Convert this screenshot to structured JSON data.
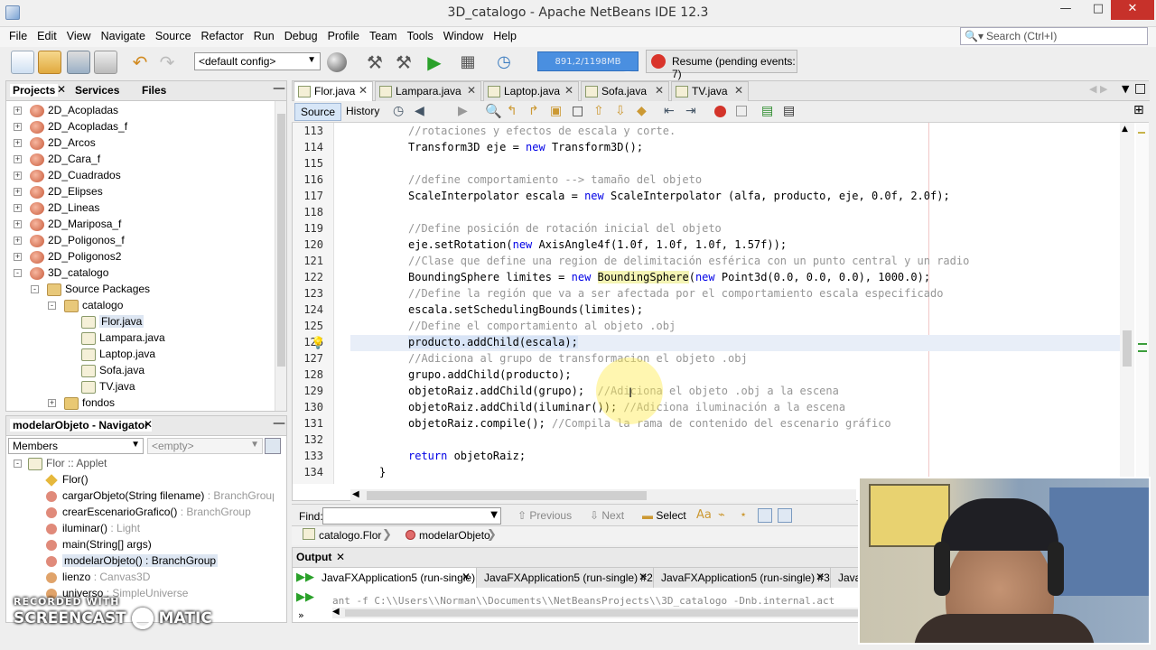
{
  "window": {
    "title": "3D_catalogo - Apache NetBeans IDE 12.3"
  },
  "menu": [
    "File",
    "Edit",
    "View",
    "Navigate",
    "Source",
    "Refactor",
    "Run",
    "Debug",
    "Profile",
    "Team",
    "Tools",
    "Window",
    "Help"
  ],
  "search": {
    "placeholder": "Search (Ctrl+I)"
  },
  "toolbar": {
    "config": "<default config>",
    "memory": "891,2/1198MB",
    "resume": "Resume (pending events: 7)"
  },
  "projects_panel": {
    "tabs": [
      "Projects",
      "Services",
      "Files"
    ],
    "items": [
      {
        "label": "2D_Acopladas",
        "level": 0,
        "icon": "project-icon",
        "expander": "+"
      },
      {
        "label": "2D_Acopladas_f",
        "level": 0,
        "icon": "project-icon",
        "expander": "+"
      },
      {
        "label": "2D_Arcos",
        "level": 0,
        "icon": "project-icon",
        "expander": "+"
      },
      {
        "label": "2D_Cara_f",
        "level": 0,
        "icon": "project-icon",
        "expander": "+"
      },
      {
        "label": "2D_Cuadrados",
        "level": 0,
        "icon": "project-icon",
        "expander": "+"
      },
      {
        "label": "2D_Elipses",
        "level": 0,
        "icon": "project-icon",
        "expander": "+"
      },
      {
        "label": "2D_Lineas",
        "level": 0,
        "icon": "project-icon",
        "expander": "+"
      },
      {
        "label": "2D_Mariposa_f",
        "level": 0,
        "icon": "project-icon",
        "expander": "+"
      },
      {
        "label": "2D_Poligonos_f",
        "level": 0,
        "icon": "project-icon",
        "expander": "+"
      },
      {
        "label": "2D_Poligonos2",
        "level": 0,
        "icon": "project-icon",
        "expander": "+"
      },
      {
        "label": "3D_catalogo",
        "level": 0,
        "icon": "project-icon",
        "expander": "-"
      },
      {
        "label": "Source Packages",
        "level": 1,
        "icon": "package-icon",
        "expander": "-"
      },
      {
        "label": "catalogo",
        "level": 2,
        "icon": "package-icon",
        "expander": "-"
      },
      {
        "label": "Flor.java",
        "level": 3,
        "icon": "java-file-icon",
        "expander": ""
      },
      {
        "label": "Lampara.java",
        "level": 3,
        "icon": "java-file-icon",
        "expander": ""
      },
      {
        "label": "Laptop.java",
        "level": 3,
        "icon": "java-file-icon",
        "expander": ""
      },
      {
        "label": "Sofa.java",
        "level": 3,
        "icon": "java-file-icon",
        "expander": ""
      },
      {
        "label": "TV.java",
        "level": 3,
        "icon": "java-file-icon",
        "expander": ""
      },
      {
        "label": "fondos",
        "level": 2,
        "icon": "folder-icon",
        "expander": "+"
      }
    ]
  },
  "navigator": {
    "title": "modelarObjeto - Navigator",
    "filter": "Members",
    "filter2": "<empty>",
    "root": "Flor :: Applet",
    "members": [
      {
        "name": "Flor()",
        "type": "",
        "icon": "constructor-icon"
      },
      {
        "name": "cargarObjeto(String filename)",
        "type": " : BranchGroup",
        "icon": "method-icon"
      },
      {
        "name": "crearEscenarioGrafico()",
        "type": " : BranchGroup",
        "icon": "method-icon"
      },
      {
        "name": "iluminar()",
        "type": " : Light",
        "icon": "method-icon"
      },
      {
        "name": "main(String[] args)",
        "type": "",
        "icon": "static-method-icon"
      },
      {
        "name": "modelarObjeto()",
        "type": " : BranchGroup",
        "icon": "method-icon"
      },
      {
        "name": "lienzo",
        "type": " : Canvas3D",
        "icon": "field-icon"
      },
      {
        "name": "universo",
        "type": " : SimpleUniverse",
        "icon": "field-icon"
      }
    ]
  },
  "editor": {
    "tabs": [
      "Flor.java",
      "Lampara.java",
      "Laptop.java",
      "Sofa.java",
      "TV.java"
    ],
    "source_tab": "Source",
    "history_tab": "History",
    "lines": [
      {
        "n": "113",
        "t": "//rotaciones y efectos de escala y corte.",
        "c": true
      },
      {
        "n": "114",
        "t": "Transform3D eje = new Transform3D();",
        "c": false
      },
      {
        "n": "115",
        "t": "",
        "c": false
      },
      {
        "n": "116",
        "t": "//define comportamiento --> tamaño del objeto",
        "c": true
      },
      {
        "n": "117",
        "t": "ScaleInterpolator escala = new ScaleInterpolator (alfa, producto, eje, 0.0f, 2.0f);",
        "c": false
      },
      {
        "n": "118",
        "t": "",
        "c": false
      },
      {
        "n": "119",
        "t": "//Define posición de rotación inicial del objeto",
        "c": true
      },
      {
        "n": "120",
        "t": "eje.setRotation(new AxisAngle4f(1.0f, 1.0f, 1.0f, 1.57f));",
        "c": false
      },
      {
        "n": "121",
        "t": "//Clase que define una region de delimitación esférica con un punto central y un radio",
        "c": true
      },
      {
        "n": "122",
        "t": "BoundingSphere limites = new BoundingSphere(new Point3d(0.0, 0.0, 0.0), 1000.0);",
        "c": false
      },
      {
        "n": "123",
        "t": "//Define la región que va a ser afectada por el comportamiento escala especificado",
        "c": true
      },
      {
        "n": "124",
        "t": "escala.setSchedulingBounds(limites);",
        "c": false
      },
      {
        "n": "125",
        "t": "//Define el comportamiento al objeto .obj",
        "c": true
      },
      {
        "n": "126",
        "t": "producto.addChild(escala);",
        "c": false
      },
      {
        "n": "127",
        "t": "//Adiciona al grupo de transformacion el objeto .obj",
        "c": true
      },
      {
        "n": "128",
        "t": "grupo.addChild(producto);",
        "c": false
      },
      {
        "n": "129",
        "t": "objetoRaiz.addChild(grupo);",
        "c": false,
        "tail": "  //Adiciona el objeto .obj a la escena"
      },
      {
        "n": "130",
        "t": "objetoRaiz.addChild(iluminar());",
        "c": false,
        "tail": " //Adiciona iluminación a la escena"
      },
      {
        "n": "131",
        "t": "objetoRaiz.compile();",
        "c": false,
        "tail": " //Compila la rama de contenido del escenario gráfico"
      },
      {
        "n": "132",
        "t": "",
        "c": false
      },
      {
        "n": "133",
        "t": "return objetoRaiz;",
        "c": false
      },
      {
        "n": "134",
        "t": "}",
        "c": false
      }
    ]
  },
  "find": {
    "label": "Find:",
    "previous": "Previous",
    "next": "Next",
    "select": "Select"
  },
  "breadcrumb": [
    "catalogo.Flor",
    "modelarObjeto"
  ],
  "output": {
    "title": "Output",
    "tabs": [
      "JavaFXApplication5 (run-single)",
      "JavaFXApplication5 (run-single) #2",
      "JavaFXApplication5 (run-single) #3",
      "Java"
    ],
    "line": "ant -f C:\\\\Users\\\\Norman\\\\Documents\\\\NetBeansProjects\\\\3D_catalogo -Dnb.internal.act"
  },
  "watermark": {
    "line1": "RECORDED WITH",
    "line2": "SCREENCAST",
    "line3": "MATIC"
  }
}
